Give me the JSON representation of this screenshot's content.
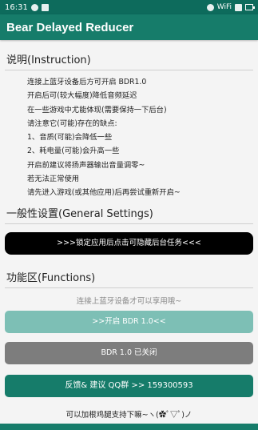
{
  "status_bar": {
    "time": "16:31",
    "network_badge": "WiFi"
  },
  "app": {
    "title": "Bear Delayed Reducer"
  },
  "instructions": {
    "heading": "说明(Instruction)",
    "lines": [
      "连接上蓝牙设备后方可开启 BDR1.0",
      "开启后可(较大幅度)降低音频延迟",
      "在一些游戏中尤能体现(需要保持一下后台)",
      "请注意它(可能)存在的缺点:",
      "1、音质(可能)会降低一些",
      "2、耗电量(可能)会升高一些",
      "开启前建议将扬声器输出音量调零~",
      "若无法正常使用",
      "请先进入游戏(或其他应用)后再尝试重新开启~"
    ]
  },
  "general_settings": {
    "heading": "一般性设置(General Settings)",
    "hide_task_button": ">>>锁定应用后点击可隐藏后台任务<<<"
  },
  "functions": {
    "heading": "功能区(Functions)",
    "hint": "连接上蓝牙设备才可以享用哦~",
    "start_button": ">>开启 BDR 1.0<<",
    "status_button": "BDR 1.0 已关闭",
    "feedback_button": "反馈& 建议 QQ群 >> 159300593",
    "donate_text": "可以加根鸡腿支持下嘛~ヽ(✿ﾟ▽ﾟ)ノ"
  },
  "colors": {
    "status_bar": "#0d6b5c",
    "app_bar": "#167c6a",
    "start_button_disabled": "#7dbfb5",
    "status_button": "#7d7d7d",
    "hide_task_button": "#000000"
  }
}
